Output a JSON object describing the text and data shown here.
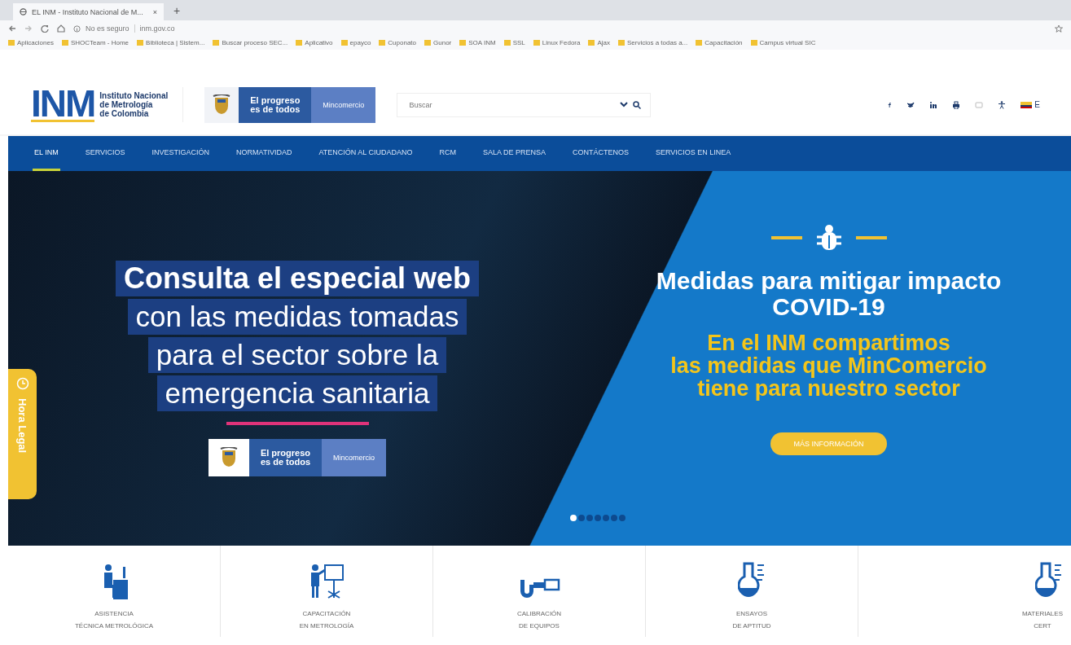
{
  "browser": {
    "tab": {
      "title": "EL INM - Instituto Nacional de M...",
      "close": "×"
    },
    "new_tab": "+",
    "security": "No es seguro",
    "url": "inm.gov.co",
    "bookmarks": [
      "Aplicaciones",
      "SHOCTeam - Home",
      "Biblioteca | Sistem...",
      "Buscar proceso SEC...",
      "Aplicativo",
      "epayco",
      "Cuponato",
      "Gunor",
      "SOA INM",
      "SSL",
      "Linux Fedora",
      "Ajax",
      "Servicios a todas a...",
      "Capacitación",
      "Campus virtual SIC"
    ]
  },
  "header": {
    "logo": {
      "letters": "INM",
      "lines": [
        "Instituto Nacional",
        "de Metrología",
        "de Colombia"
      ]
    },
    "gov_badge": {
      "slogan": [
        "El progreso",
        "es de todos"
      ],
      "ministry": "Mincomercio"
    },
    "search": {
      "placeholder": "Buscar"
    },
    "language": "E"
  },
  "nav": [
    {
      "label": "EL INM",
      "selected": true
    },
    {
      "label": "SERVICIOS",
      "selected": false
    },
    {
      "label": "INVESTIGACIÓN",
      "selected": false
    },
    {
      "label": "NORMATIVIDAD",
      "selected": false
    },
    {
      "label": "ATENCIÓN AL CIUDADANO",
      "selected": false
    },
    {
      "label": "RCM",
      "selected": false
    },
    {
      "label": "SALA DE PRENSA",
      "selected": false
    },
    {
      "label": "CONTÁCTENOS",
      "selected": false
    },
    {
      "label": "SERVICIOS EN LINEA",
      "selected": false
    }
  ],
  "hero": {
    "left": {
      "heading": "Consulta el especial web",
      "lines": [
        "con las medidas tomadas",
        "para el sector sobre la",
        "emergencia sanitaria"
      ],
      "badge": {
        "slogan": [
          "El progreso",
          "es de todos"
        ],
        "ministry": "Mincomercio"
      }
    },
    "right": {
      "title": [
        "Medidas para mitigar impacto",
        "COVID-19"
      ],
      "subtitle": [
        "En el INM compartimos",
        "las medidas que MinComercio",
        "tiene para nuestro sector"
      ],
      "button": "MÁS INFORMACIÓN"
    },
    "side_tab": "Hora Legal",
    "dots": [
      {
        "selected": true
      },
      {
        "selected": false
      },
      {
        "selected": false
      },
      {
        "selected": false
      },
      {
        "selected": false
      },
      {
        "selected": false
      },
      {
        "selected": false
      }
    ]
  },
  "services": [
    {
      "lines": [
        "ASISTENCIA",
        "TÉCNICA METROLÓGICA"
      ]
    },
    {
      "lines": [
        "CAPACITACIÓN",
        "EN METROLOGÍA"
      ]
    },
    {
      "lines": [
        "CALIBRACIÓN",
        "DE EQUIPOS"
      ]
    },
    {
      "lines": [
        "ENSAYOS",
        "DE APTITUD"
      ]
    },
    {
      "lines": [
        "MATERIALES",
        "CERT"
      ]
    }
  ]
}
